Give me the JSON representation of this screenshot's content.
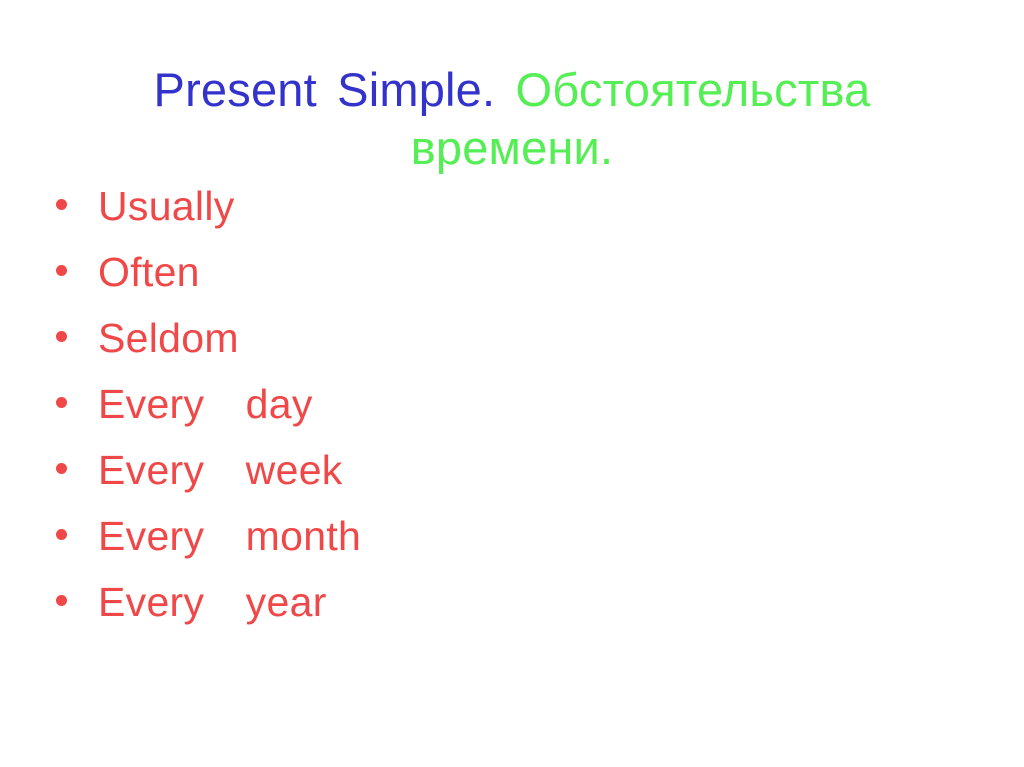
{
  "slide": {
    "background_color": "#ffffff",
    "title": {
      "part_en": "Present  Simple.",
      "part_ru": "Обстоятельства времени.",
      "color_en": "#3333cc",
      "color_ru": "#55ee55"
    },
    "bullets": {
      "marker": "round-dot",
      "marker_color": "#f04848",
      "text_color": "#f04848",
      "items": [
        {
          "label": "Usually"
        },
        {
          "label": "Often"
        },
        {
          "label": "Seldom"
        },
        {
          "label": "Every  day"
        },
        {
          "label": "Every  week"
        },
        {
          "label": "Every  month"
        },
        {
          "label": "Every  year"
        }
      ]
    }
  }
}
